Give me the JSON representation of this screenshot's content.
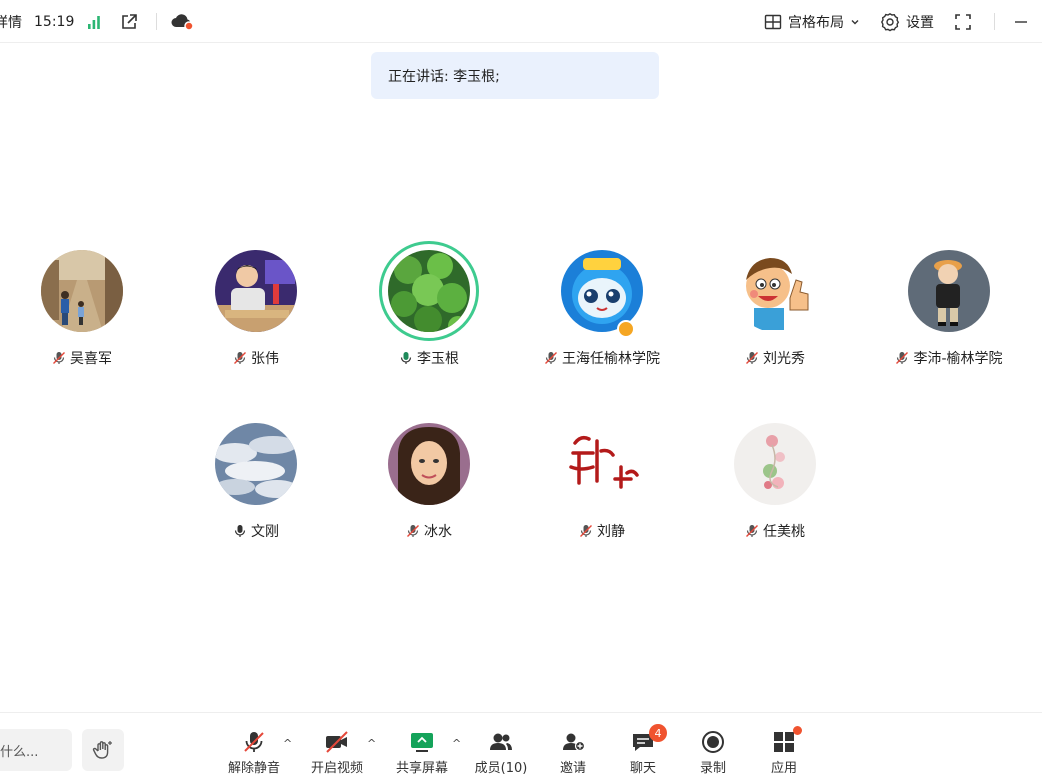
{
  "topbar": {
    "details_label": "详情",
    "time": "15:19",
    "layout_label": "宫格布局",
    "settings_label": "设置"
  },
  "speaking": {
    "text": "正在讲话: 李玉根;"
  },
  "participants": [
    {
      "name": "吴喜军",
      "mic": "muted"
    },
    {
      "name": "张伟",
      "mic": "muted"
    },
    {
      "name": "李玉根",
      "mic": "on",
      "speaking": true
    },
    {
      "name": "王海任榆林学院",
      "mic": "muted"
    },
    {
      "name": "刘光秀",
      "mic": "muted"
    },
    {
      "name": "李沛-榆林学院",
      "mic": "muted"
    },
    {
      "name": "文刚",
      "mic": "on"
    },
    {
      "name": "冰水",
      "mic": "muted"
    },
    {
      "name": "刘静",
      "mic": "muted"
    },
    {
      "name": "任美桃",
      "mic": "muted"
    }
  ],
  "bottombar": {
    "chat_placeholder": "什么...",
    "unmute_label": "解除静音",
    "video_label": "开启视频",
    "share_label": "共享屏幕",
    "members_label": "成员(10)",
    "invite_label": "邀请",
    "chat_label": "聊天",
    "chat_badge": "4",
    "record_label": "录制",
    "apps_label": "应用"
  },
  "colors": {
    "speaking_ring": "#3ecb8f",
    "badge": "#f0532f",
    "signal": "#2bb673",
    "banner_bg": "#eaf1fd",
    "share_icon": "#14a35a"
  }
}
